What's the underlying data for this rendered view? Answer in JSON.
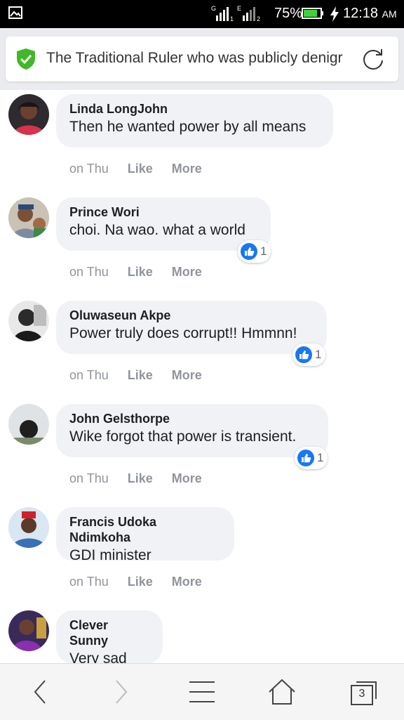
{
  "status_bar": {
    "battery_percent": "75%",
    "time": "12:18",
    "ampm": "AM",
    "sim1_label": "G",
    "sim2_label": "E",
    "sim1_index": "1",
    "sim2_index": "2"
  },
  "address_bar": {
    "url_text": "The Traditional Ruler who was publicly denigr",
    "secure_color": "#42b72a"
  },
  "comments": [
    {
      "author": "Linda LongJohn",
      "text": "Then he wanted power by all means",
      "time": "on Thu",
      "like": "Like",
      "more": "More"
    },
    {
      "author": "Prince Wori",
      "text": "choi. Na wao. what a world",
      "time": "on Thu",
      "like": "Like",
      "more": "More",
      "reactions": "1"
    },
    {
      "author": "Oluwaseun Akpe",
      "text": "Power truly does corrupt!! Hmmnn!",
      "time": "on Thu",
      "like": "Like",
      "more": "More",
      "reactions": "1"
    },
    {
      "author": "John Gelsthorpe",
      "text": "Wike forgot that power is transient.",
      "time": "on Thu",
      "like": "Like",
      "more": "More",
      "reactions": "1"
    },
    {
      "author": "Francis Udoka Ndimkoha",
      "text": "GDI minister",
      "time": "on Thu",
      "like": "Like",
      "more": "More"
    },
    {
      "author": "Clever Sunny",
      "text": "Very sad"
    }
  ],
  "bottom_nav": {
    "tabs_count": "3"
  },
  "colors": {
    "like_blue": "#1877f2",
    "bubble_bg": "#f0f2f5",
    "meta_gray": "#90949c"
  }
}
